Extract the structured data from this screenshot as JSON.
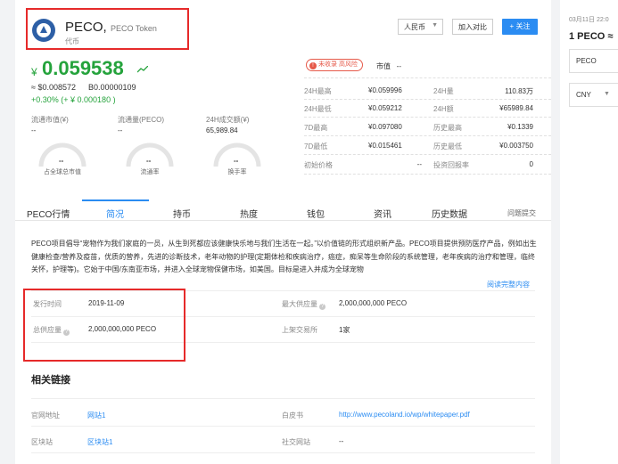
{
  "header": {
    "symbol": "PECO,",
    "full_name": "PECO Token",
    "type": "代币",
    "currency_select": "人民币",
    "compare_button": "加入对比",
    "follow_button": "+ 关注"
  },
  "price": {
    "currency_symbol": "¥",
    "value": "0.059538",
    "usd": "≈ $0.008572",
    "btc": "B0.00000109",
    "change": "+0.30%  (+ ¥ 0.000180 )"
  },
  "stats": {
    "circ_mcap_label": "流通市值(¥)",
    "circ_mcap_value": "--",
    "circ_supply_label": "流通量(PECO)",
    "circ_supply_value": "--",
    "volume_label": "24H成交额(¥)",
    "volume_value": "65,989.84",
    "gauges": [
      {
        "value": "--",
        "label": "占全球总市值"
      },
      {
        "value": "--",
        "label": "流通率"
      },
      {
        "value": "--",
        "label": "换手率"
      }
    ]
  },
  "market": {
    "warning": "未收录 高风险",
    "mcap_label": "市值",
    "mcap_value": "--",
    "rows": [
      {
        "k1": "24H最高",
        "v1": "¥0.059996",
        "k2": "24H量",
        "v2": "110.83万"
      },
      {
        "k1": "24H最低",
        "v1": "¥0.059212",
        "k2": "24H额",
        "v2": "¥65989.84"
      },
      {
        "k1": "7D最高",
        "v1": "¥0.097080",
        "k2": "历史最高",
        "v2": "¥0.1339"
      },
      {
        "k1": "7D最低",
        "v1": "¥0.015461",
        "k2": "历史最低",
        "v2": "¥0.003750"
      },
      {
        "k1": "初始价格",
        "v1": "--",
        "k2": "投资回报率",
        "v2": "0"
      }
    ]
  },
  "tabs": [
    "PECO行情",
    "简况",
    "持币",
    "热度",
    "钱包",
    "资讯",
    "历史数据",
    "问题提交"
  ],
  "description": {
    "text": "PECO项目倡导“宠物作为我们家庭的一员，从生到死都应该健康快乐地与我们生活在一起。”以价值链的形式组织新产品。PECO项目提供预防医疗产品，例如出生健康检查/营养及疫苗，优质的营养，先进的诊断技术，老年动物的护理(定期体检和疾病治疗，癌症，痴呆等生命阶段的系统管理，老年疾病的治疗和管理，临终关怀，护理等)。它始于中国/东南亚市场，并进入全球宠物保健市场，如美国。目标是进入并成为全球宠物",
    "read_more": "阅读完整内容"
  },
  "info": {
    "issue_date_label": "发行时间",
    "issue_date": "2019-11-09",
    "max_supply_label": "最大供应量",
    "max_supply": "2,000,000,000 PECO",
    "total_supply_label": "总供应量",
    "total_supply": "2,000,000,000 PECO",
    "exchanges_label": "上架交易所",
    "exchanges": "1家"
  },
  "links": {
    "title": "相关链接",
    "website_label": "官网地址",
    "website": "网站1",
    "whitepaper_label": "白皮书",
    "whitepaper": "http://www.pecoland.io/wp/whitepaper.pdf",
    "explorer_label": "区块站",
    "explorer": "区块站1",
    "social_label": "社交网站",
    "social": "--"
  },
  "side": {
    "date": "03月11日 22:0",
    "rate": "1 PECO ≈",
    "coin": "PECO",
    "currency": "CNY"
  },
  "colors": {
    "up": "#25a33c",
    "accent": "#2b8cf2",
    "highlight": "#e62a2a"
  }
}
